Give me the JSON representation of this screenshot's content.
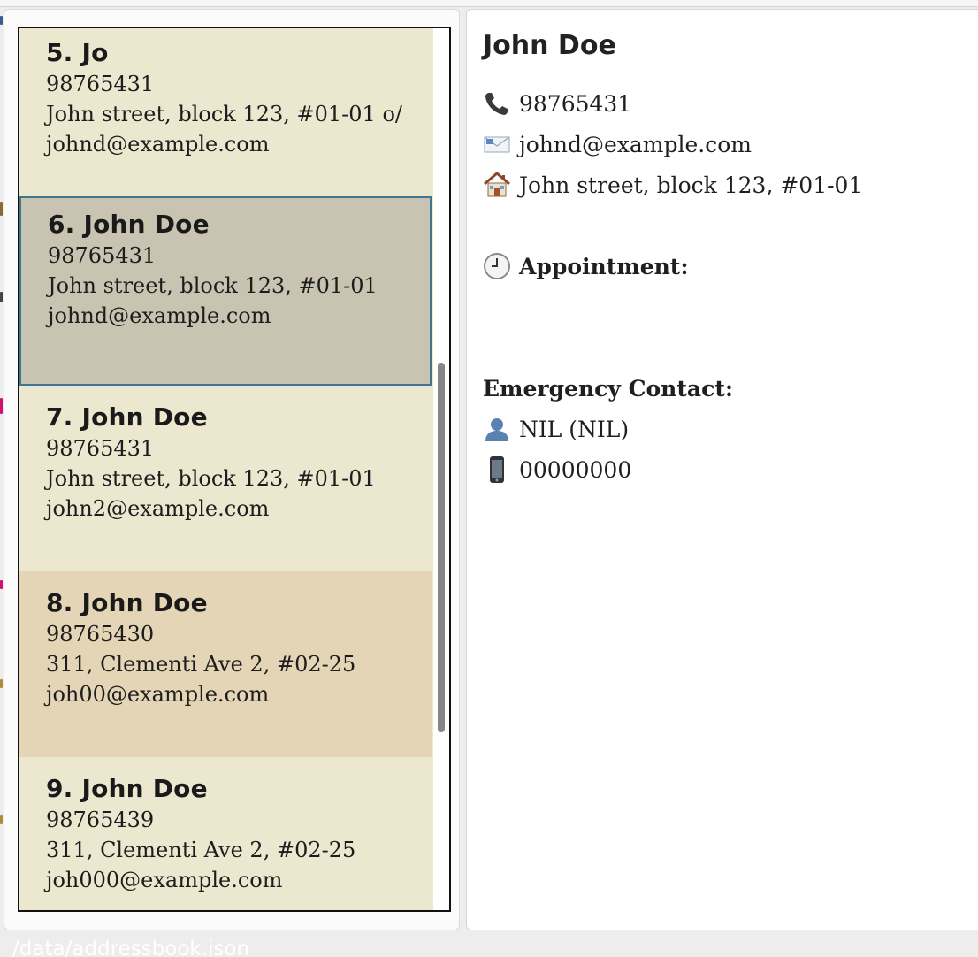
{
  "person_list": {
    "cards": [
      {
        "name": "5. Jo",
        "phone": "98765431",
        "address": "John street, block 123, #01-01 o/",
        "email": "johnd@example.com"
      },
      {
        "name": "6. John Doe",
        "phone": "98765431",
        "address": "John street, block 123, #01-01",
        "email": "johnd@example.com"
      },
      {
        "name": "7. John Doe",
        "phone": "98765431",
        "address": "John street, block 123, #01-01",
        "email": "john2@example.com"
      },
      {
        "name": "8. John Doe",
        "phone": "98765430",
        "address": "311, Clementi Ave 2, #02-25",
        "email": "joh00@example.com"
      },
      {
        "name": "9. John Doe",
        "phone": "98765439",
        "address": "311, Clementi Ave 2, #02-25",
        "email": "joh000@example.com"
      }
    ],
    "selected_index": 1
  },
  "detail": {
    "name": "John Doe",
    "phone": "98765431",
    "email": "johnd@example.com",
    "address": "John street, block 123, #01-01",
    "appointment_label": "Appointment:",
    "emergency_label": "Emergency Contact:",
    "emergency_name": "NIL (NIL)",
    "emergency_phone": "00000000",
    "icons": {
      "phone": "phone-receiver-icon",
      "email": "envelope-icon",
      "address": "house-icon",
      "appointment": "clock-icon",
      "emergency_name": "person-icon",
      "emergency_phone": "mobile-phone-icon"
    }
  },
  "status_bar": {
    "path": "/data/addressbook.json"
  },
  "colors": {
    "card_beige": "#ece8d0",
    "card_tan": "#e3d5b5",
    "card_selected": "#c8c4b1",
    "selected_border": "#3e7590"
  }
}
